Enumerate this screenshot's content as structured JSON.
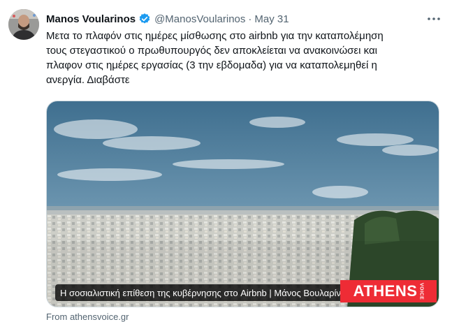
{
  "author": {
    "display_name": "Manos Voularinos",
    "handle": "@ManosVoularinos",
    "separator": "·",
    "date": "May 31",
    "verified_color": "#1d9bf0"
  },
  "tweet": {
    "lines": [
      "Μετα το πλαφόν στις ημέρες μίσθωσης στο airbnb για την καταπολέμηση",
      "τους στεγαστικού ο πρωθυπουργός δεν αποκλείεται να ανακοινώσει και",
      "πλαφον στις ημέρες εργασίας (3 την εβδομαδα) για να καταπολεμηθεί η",
      "ανεργία. Διαβάστε"
    ]
  },
  "card": {
    "caption": "Η σοσιαλιστική επίθεση της κυβέρνησης στο Airbnb | Μάνος Βουλαρίνος",
    "logo_text": "ATHENS",
    "logo_sub": "VOICE",
    "logo_color": "#ee2c35"
  },
  "source": {
    "text": "From athensvoice.gr"
  },
  "icons": {
    "more": "more-icon",
    "verified": "verified-badge-icon"
  }
}
